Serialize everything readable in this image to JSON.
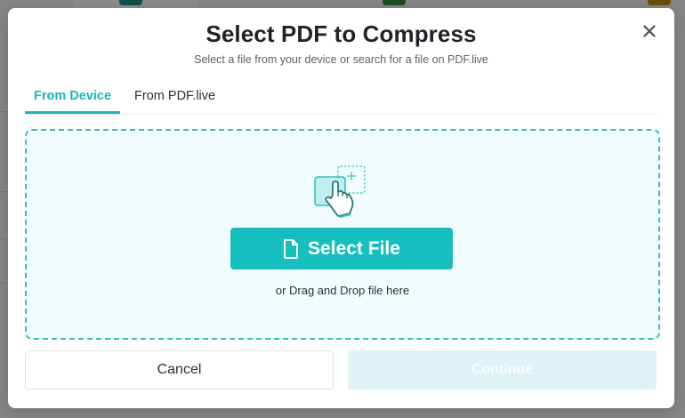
{
  "dialog": {
    "title": "Select PDF to Compress",
    "subtitle": "Select a file from your device or search for a file on PDF.live"
  },
  "tabs": [
    {
      "label": "From Device",
      "active": true
    },
    {
      "label": "From PDF.live",
      "active": false
    }
  ],
  "dropzone": {
    "icon": "tap-hand-icon",
    "select_button_label": "Select File",
    "select_button_icon": "file-icon",
    "drag_text": "or Drag and Drop file here"
  },
  "footer": {
    "cancel_label": "Cancel",
    "continue_label": "Continue",
    "continue_enabled": false
  },
  "colors": {
    "accent": "#16bfbf",
    "dropzone_border": "#2ec3bd",
    "dropzone_bg": "#f3fcfd",
    "continue_disabled_bg": "#dff3f4"
  }
}
